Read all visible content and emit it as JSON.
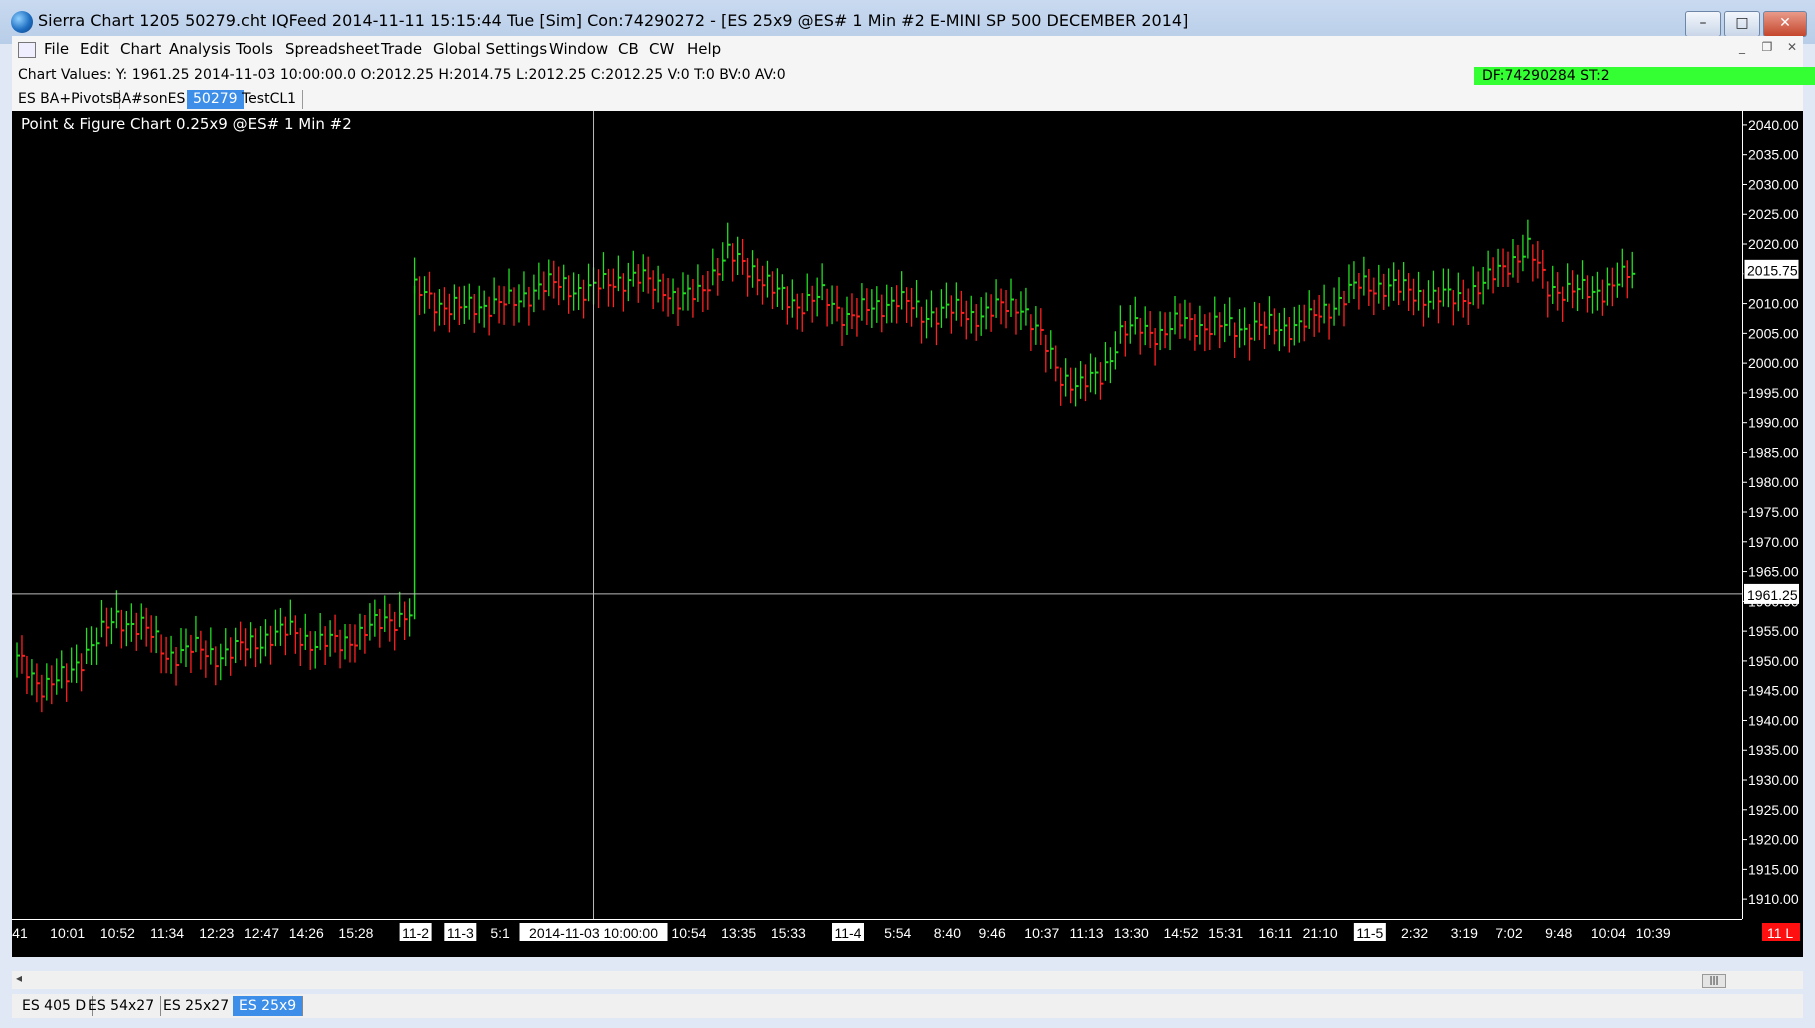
{
  "window": {
    "title": "Sierra Chart 1205 50279.cht  IQFeed 2014-11-11  15:15:44 Tue [Sim]  Con:74290272 - [ES 25x9  @ES#  1 Min   #2  E-MINI SP 500 DECEMBER 2014]",
    "btn_min": "–",
    "btn_max": "□",
    "btn_close": "✕"
  },
  "menu": {
    "items": [
      "File",
      "Edit",
      "Chart",
      "Analysis",
      "Tools",
      "Spreadsheet",
      "Trade",
      "Global Settings",
      "Window",
      "CB",
      "CW",
      "Help"
    ],
    "mdi_min": "_",
    "mdi_restore": "❐",
    "mdi_close": "✕"
  },
  "values_bar": {
    "text": "Chart Values: Y: 1961.25  2014-11-03  10:00:00.0  O:2012.25  H:2014.75  L:2012.25  C:2012.25  V:0  T:0  BV:0  AV:0",
    "status": "DF:74290284  ST:2"
  },
  "chart_tabs": [
    "ES BA+Pivots",
    "BA#sonES",
    "50279",
    "TestCL1"
  ],
  "chart": {
    "title": "Point & Figure Chart 0.25x9 @ES#  1 Min   #2",
    "crosshair_y_label": "1961.25",
    "crosshair_x_label": "2014-11-03  10:00:00",
    "last_price_label": "2015.75",
    "corner_label": "11 L",
    "colors": {
      "up": "#22dd22",
      "down": "#ff2020",
      "background": "#000000",
      "axis_text": "#ffffff"
    }
  },
  "chart_data": {
    "type": "bar",
    "y_ticks": [
      "2040.00",
      "2035.00",
      "2030.00",
      "2025.00",
      "2020.00",
      "2015.00",
      "2010.00",
      "2005.00",
      "2000.00",
      "1995.00",
      "1990.00",
      "1985.00",
      "1980.00",
      "1975.00",
      "1970.00",
      "1965.00",
      "1960.00",
      "1955.00",
      "1950.00",
      "1945.00",
      "1940.00",
      "1935.00",
      "1930.00",
      "1925.00",
      "1920.00",
      "1915.00",
      "1910.00"
    ],
    "ylim": [
      1907,
      2042
    ],
    "x_ticks": [
      {
        "label": ":41",
        "i": 0
      },
      {
        "label": "10:01",
        "i": 10
      },
      {
        "label": "10:52",
        "i": 20
      },
      {
        "label": "11:34",
        "i": 30
      },
      {
        "label": "12:23",
        "i": 40
      },
      {
        "label": "12:47",
        "i": 49
      },
      {
        "label": "14:26",
        "i": 58
      },
      {
        "label": "15:28",
        "i": 68
      },
      {
        "label": "11-2",
        "i": 80,
        "box": true
      },
      {
        "label": "11-3",
        "i": 89,
        "box": true
      },
      {
        "label": "5:1",
        "i": 97
      },
      {
        "label": "10:54",
        "i": 135
      },
      {
        "label": "13:35",
        "i": 145
      },
      {
        "label": "15:33",
        "i": 155
      },
      {
        "label": "11-4",
        "i": 167,
        "box": true
      },
      {
        "label": "5:54",
        "i": 177
      },
      {
        "label": "8:40",
        "i": 187
      },
      {
        "label": "9:46",
        "i": 196
      },
      {
        "label": "10:37",
        "i": 206
      },
      {
        "label": "11:13",
        "i": 215
      },
      {
        "label": "13:30",
        "i": 224
      },
      {
        "label": "14:52",
        "i": 234
      },
      {
        "label": "15:31",
        "i": 243
      },
      {
        "label": "16:11",
        "i": 253
      },
      {
        "label": "21:10",
        "i": 262
      },
      {
        "label": "11-5",
        "i": 272,
        "box": true
      },
      {
        "label": "2:32",
        "i": 281
      },
      {
        "label": "3:19",
        "i": 291
      },
      {
        "label": "7:02",
        "i": 300
      },
      {
        "label": "9:48",
        "i": 310
      },
      {
        "label": "10:04",
        "i": 320
      },
      {
        "label": "10:39",
        "i": 329
      }
    ],
    "anchors": [
      [
        0,
        1950
      ],
      [
        5,
        1946
      ],
      [
        10,
        1947
      ],
      [
        15,
        1953
      ],
      [
        20,
        1957
      ],
      [
        25,
        1956
      ],
      [
        30,
        1951
      ],
      [
        35,
        1952
      ],
      [
        40,
        1951
      ],
      [
        45,
        1952
      ],
      [
        50,
        1954
      ],
      [
        55,
        1955
      ],
      [
        60,
        1953
      ],
      [
        65,
        1953
      ],
      [
        70,
        1955
      ],
      [
        75,
        1957
      ],
      [
        79,
        1958
      ],
      [
        80,
        2012
      ],
      [
        85,
        2010
      ],
      [
        90,
        2009
      ],
      [
        95,
        2010
      ],
      [
        100,
        2010
      ],
      [
        105,
        2013
      ],
      [
        110,
        2013
      ],
      [
        115,
        2012
      ],
      [
        120,
        2014
      ],
      [
        125,
        2014
      ],
      [
        130,
        2013
      ],
      [
        133,
        2010
      ],
      [
        137,
        2012
      ],
      [
        140,
        2015
      ],
      [
        143,
        2018
      ],
      [
        148,
        2016
      ],
      [
        152,
        2012
      ],
      [
        157,
        2010
      ],
      [
        162,
        2011
      ],
      [
        167,
        2008
      ],
      [
        172,
        2009
      ],
      [
        177,
        2011
      ],
      [
        182,
        2008
      ],
      [
        187,
        2009
      ],
      [
        192,
        2008
      ],
      [
        197,
        2009
      ],
      [
        202,
        2010
      ],
      [
        206,
        2004
      ],
      [
        210,
        1998
      ],
      [
        214,
        1996
      ],
      [
        218,
        1998
      ],
      [
        222,
        2005
      ],
      [
        226,
        2006
      ],
      [
        230,
        2005
      ],
      [
        235,
        2007
      ],
      [
        240,
        2006
      ],
      [
        245,
        2006
      ],
      [
        250,
        2006
      ],
      [
        255,
        2006
      ],
      [
        260,
        2007
      ],
      [
        265,
        2010
      ],
      [
        270,
        2013
      ],
      [
        275,
        2013
      ],
      [
        280,
        2012
      ],
      [
        285,
        2011
      ],
      [
        290,
        2011
      ],
      [
        295,
        2013
      ],
      [
        300,
        2017
      ],
      [
        304,
        2019
      ],
      [
        308,
        2013
      ],
      [
        312,
        2012
      ],
      [
        317,
        2012
      ],
      [
        321,
        2013
      ],
      [
        325,
        2015
      ]
    ],
    "crosshair": {
      "y": 1961.25,
      "i": 116
    }
  },
  "bottom_tabs": [
    "ES 405 D",
    "ES 54x27",
    "ES 25x27",
    "ES 25x9"
  ],
  "scrollbar": {
    "left_arrow": "◂",
    "thumb": "|||"
  }
}
